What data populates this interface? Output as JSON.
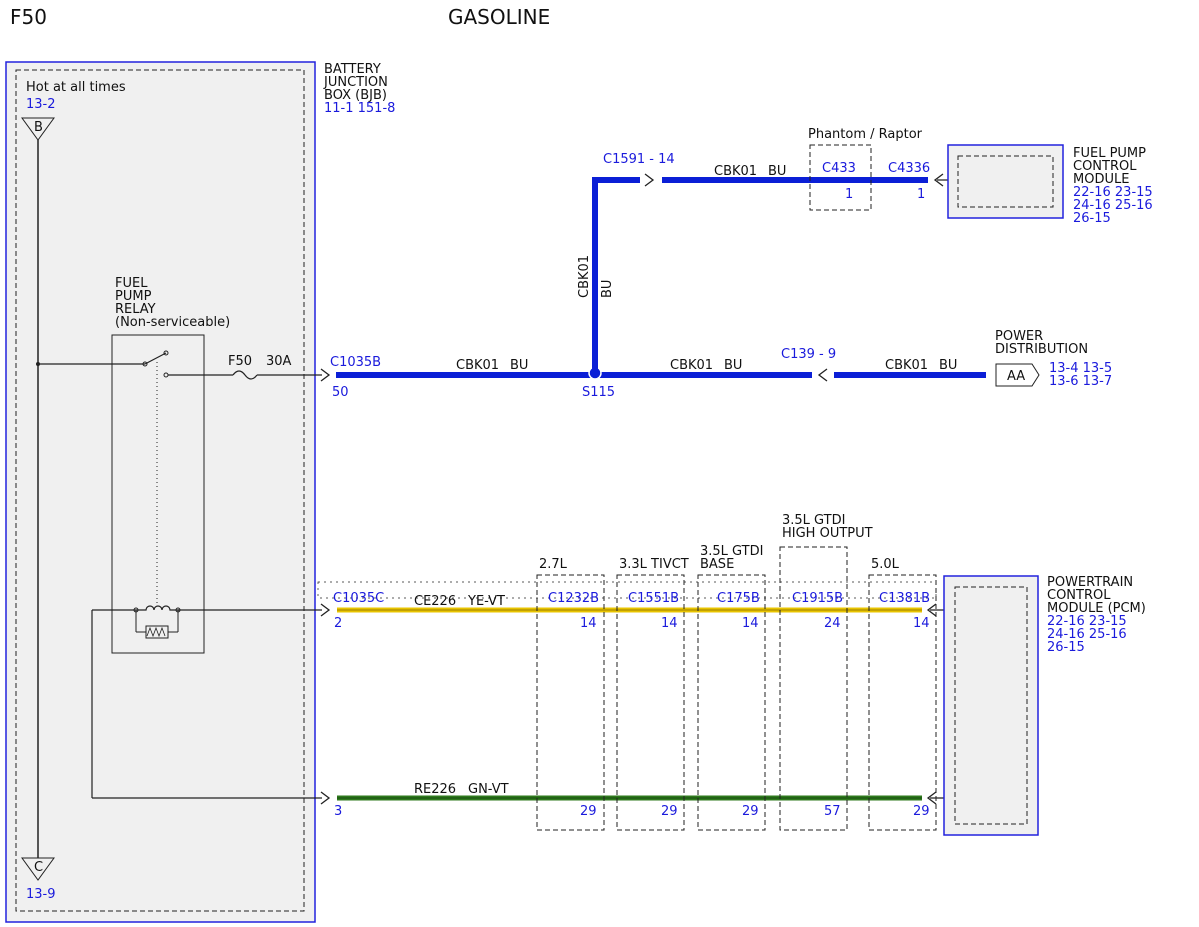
{
  "header": {
    "left": "F50",
    "center": "GASOLINE"
  },
  "bjb": {
    "title": [
      "BATTERY",
      "JUNCTION",
      "BOX (BJB)"
    ],
    "refs": "11-1   151-8",
    "hot_label": "Hot at all times",
    "top_ref": "13-2",
    "bottom_ref": "13-9",
    "node_top": "B",
    "node_bottom": "C"
  },
  "relay": {
    "label": [
      "FUEL",
      "PUMP",
      "RELAY",
      "(Non-serviceable)"
    ],
    "fuse": "F50",
    "fuse_rating": "30A"
  },
  "conn_main": {
    "name": "C1035B",
    "pin": "50"
  },
  "splice": "S115",
  "wire": {
    "circuit": "CBK01",
    "color": "BU"
  },
  "wire_vertical": {
    "circuit": "CBK01",
    "color": "BU"
  },
  "conn_c1591": "C1591 - 14",
  "conn_c139": "C139  -  9",
  "phantom": {
    "label": "Phantom / Raptor",
    "conn": "C433",
    "pin": "1"
  },
  "fpcm": {
    "conn": "C4336",
    "pin": "1",
    "label": [
      "FUEL PUMP",
      "CONTROL",
      "MODULE"
    ],
    "refs": [
      "22-16 23-15",
      "24-16 25-16",
      "26-15"
    ]
  },
  "power_dist": {
    "label": [
      "POWER",
      "DISTRIBUTION"
    ],
    "tag": "AA",
    "refs": [
      "13-4  13-5",
      "13-6  13-7"
    ]
  },
  "conn_c": {
    "name": "C1035C",
    "pin_yellow": "2",
    "pin_green": "3"
  },
  "wire_yellow": {
    "circuit": "CE226",
    "color": "YE-VT"
  },
  "wire_green": {
    "circuit": "RE226",
    "color": "GN-VT"
  },
  "variants": [
    {
      "label": [
        "2.7L"
      ],
      "conn": "C1232B",
      "pin1": "14",
      "pin2": "29"
    },
    {
      "label": [
        "3.3L TIVCT"
      ],
      "conn": "C1551B",
      "pin1": "14",
      "pin2": "29"
    },
    {
      "label": [
        "3.5L GTDI",
        "BASE"
      ],
      "conn": "C175B",
      "pin1": "14",
      "pin2": "29"
    },
    {
      "label": [
        "3.5L GTDI",
        "HIGH OUTPUT"
      ],
      "conn": "C1915B",
      "pin1": "24",
      "pin2": "57"
    },
    {
      "label": [
        "5.0L"
      ],
      "conn": "C1381B",
      "pin1": "14",
      "pin2": "29"
    }
  ],
  "pcm": {
    "label": [
      "POWERTRAIN",
      "CONTROL",
      "MODULE (PCM)"
    ],
    "refs": [
      "22-16 23-15",
      "24-16 25-16",
      "26-15"
    ]
  },
  "colors": {
    "blue_wire": "#0b1fd6",
    "label_blue": "#1a1adc",
    "yellow_wire": "#e8c400",
    "green_wire": "#2f7a1d",
    "box_fill": "#f0f0f0"
  }
}
